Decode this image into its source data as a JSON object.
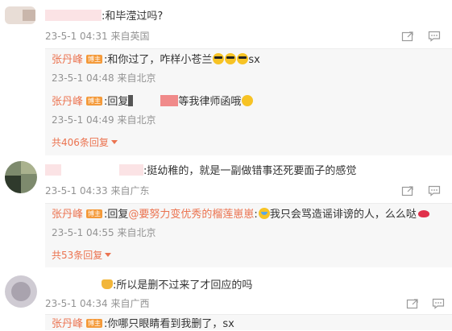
{
  "comments": [
    {
      "text": ":和毕滢过吗?",
      "time": "23-5-1 04:31",
      "location": "来自英国",
      "replies": [
        {
          "author": "张丹峰",
          "badge": "博主",
          "text_a": ":和你过了，咋样小苍兰",
          "text_b": "sx",
          "time": "23-5-1 04:48",
          "location": "来自北京"
        },
        {
          "author": "张丹峰",
          "badge": "博主",
          "text_a": ":回复",
          "text_b": "等我律师函哦",
          "time": "23-5-1 04:49",
          "location": "来自北京"
        }
      ],
      "reply_count": "共406条回复"
    },
    {
      "text": ":挺幼稚的，就是一副做错事还死要面子的感觉",
      "time": "23-5-1 04:33",
      "location": "来自广东",
      "replies": [
        {
          "author": "张丹峰",
          "badge": "博主",
          "text_a": ":回复",
          "mention": "@要努力变优秀的榴莲崽崽",
          "text_b": ":",
          "text_c": "我只会骂造谣诽谤的人，么么哒",
          "time": "23-5-1 04:55",
          "location": "来自北京"
        }
      ],
      "reply_count": "共53条回复"
    },
    {
      "text": ":所以是删不过来了才回应的吗",
      "time": "23-5-1 04:34",
      "location": "来自广西",
      "replies": [
        {
          "author": "张丹峰",
          "badge": "博主",
          "text_a": ":你哪只眼睛看到我删了，",
          "text_b": "sx"
        }
      ]
    }
  ],
  "icons": {
    "forward": "forward-icon",
    "comment": "comment-icon",
    "cool_emoji": "sunglasses-emoji-icon",
    "cry_laugh_emoji": "laugh-cry-emoji-icon",
    "kiss": "kiss-lips-icon",
    "crown": "crown-emoji-icon"
  },
  "colors": {
    "accent": "#eb7350",
    "badge": "#f49a3a",
    "meta": "#939393",
    "reply_bg": "#f7f7f7"
  }
}
